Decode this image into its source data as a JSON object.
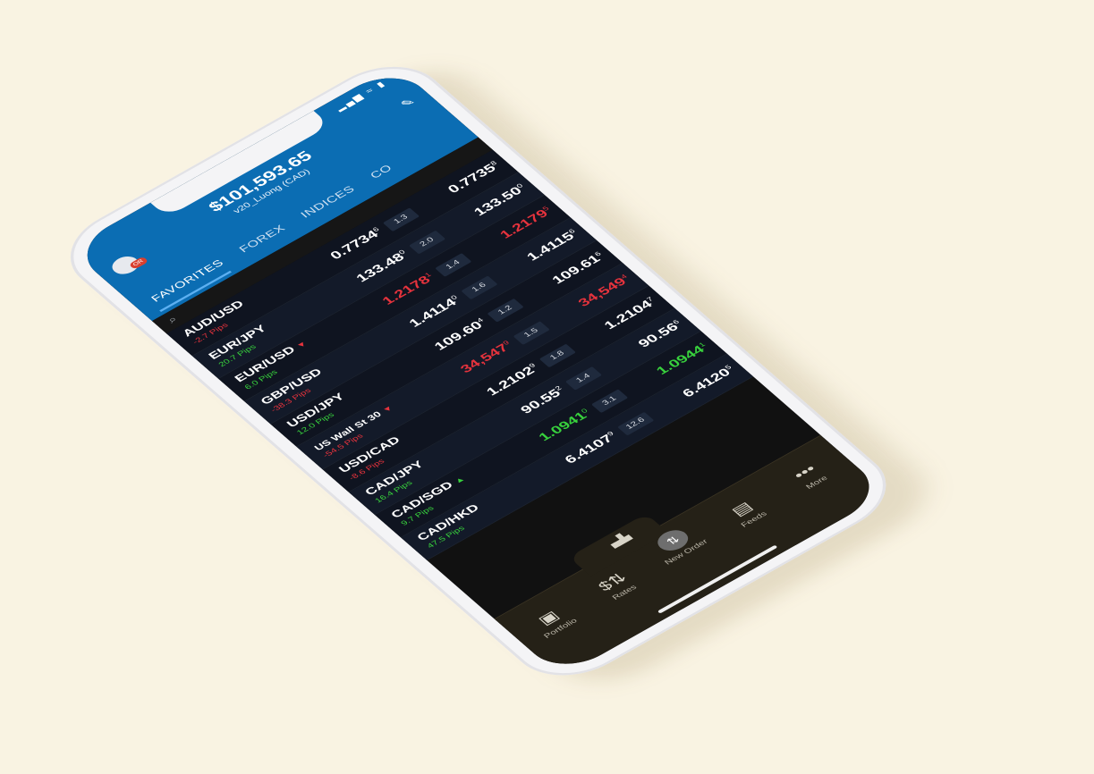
{
  "status": {
    "time": "",
    "icons": "▂▄▆ ≈ ▮"
  },
  "header": {
    "balance": "$101,593.65",
    "account": "v20_Luong (CAD)",
    "avatar_badge": "OR",
    "edit_icon": "pencil-icon",
    "tabs": [
      {
        "label": "FAVORITES",
        "active": true
      },
      {
        "label": "FOREX",
        "active": false
      },
      {
        "label": "INDICES",
        "active": false
      },
      {
        "label": "CO",
        "active": false
      }
    ]
  },
  "colors": {
    "header": "#0b6db3",
    "red": "#e6333d",
    "green": "#38d13d",
    "nav": "#252117"
  },
  "rates": [
    {
      "instrument": "AUD/USD",
      "trend": "",
      "pips": "-2.7 Pips",
      "pips_color": "red",
      "bid": "0.7734",
      "bid_sup": "6",
      "bid_color": "white",
      "spread": "1.3",
      "ask": "0.7735",
      "ask_sup": "8",
      "ask_color": "white"
    },
    {
      "instrument": "EUR/JPY",
      "trend": "",
      "pips": "20.7 Pips",
      "pips_color": "green",
      "bid": "133.48",
      "bid_sup": "0",
      "bid_color": "white",
      "spread": "2.0",
      "ask": "133.50",
      "ask_sup": "0",
      "ask_color": "white"
    },
    {
      "instrument": "EUR/USD",
      "trend": "▼",
      "trend_color": "red",
      "pips": "6.0 Pips",
      "pips_color": "green",
      "bid": "1.2178",
      "bid_sup": "1",
      "bid_color": "red",
      "spread": "1.4",
      "ask": "1.2179",
      "ask_sup": "5",
      "ask_color": "red"
    },
    {
      "instrument": "GBP/USD",
      "trend": "",
      "pips": "-38.3 Pips",
      "pips_color": "red",
      "bid": "1.4114",
      "bid_sup": "0",
      "bid_color": "white",
      "spread": "1.6",
      "ask": "1.4115",
      "ask_sup": "6",
      "ask_color": "white"
    },
    {
      "instrument": "USD/JPY",
      "trend": "",
      "pips": "12.0 Pips",
      "pips_color": "green",
      "bid": "109.60",
      "bid_sup": "4",
      "bid_color": "white",
      "spread": "1.2",
      "ask": "109.61",
      "ask_sup": "6",
      "ask_color": "white"
    },
    {
      "instrument": "US Wall St 30",
      "small": true,
      "trend": "▼",
      "trend_color": "red",
      "pips": "-54.5 Pips",
      "pips_color": "red",
      "bid": "34,547",
      "bid_sup": "9",
      "bid_color": "red",
      "spread": "1.5",
      "ask": "34,549",
      "ask_sup": "4",
      "ask_color": "red"
    },
    {
      "instrument": "USD/CAD",
      "trend": "",
      "pips": "-8.6 Pips",
      "pips_color": "red",
      "bid": "1.2102",
      "bid_sup": "9",
      "bid_color": "white",
      "spread": "1.8",
      "ask": "1.2104",
      "ask_sup": "7",
      "ask_color": "white"
    },
    {
      "instrument": "CAD/JPY",
      "trend": "",
      "pips": "16.4 Pips",
      "pips_color": "green",
      "bid": "90.55",
      "bid_sup": "2",
      "bid_color": "white",
      "spread": "1.4",
      "ask": "90.56",
      "ask_sup": "6",
      "ask_color": "white"
    },
    {
      "instrument": "CAD/SGD",
      "trend": "▲",
      "trend_color": "green",
      "pips": "9.7 Pips",
      "pips_color": "green",
      "bid": "1.0941",
      "bid_sup": "0",
      "bid_color": "green",
      "spread": "3.1",
      "ask": "1.0944",
      "ask_sup": "1",
      "ask_color": "green"
    },
    {
      "instrument": "CAD/HKD",
      "trend": "",
      "pips": "47.5 Pips",
      "pips_color": "green",
      "bid": "6.4107",
      "bid_sup": "9",
      "bid_color": "white",
      "spread": "12.6",
      "ask": "6.4120",
      "ask_sup": "5",
      "ask_color": "white"
    }
  ],
  "bottom_nav": {
    "items": [
      {
        "key": "portfolio",
        "label": "Portfolio",
        "icon": "briefcase-icon",
        "glyph": "▣"
      },
      {
        "key": "rates",
        "label": "Rates",
        "icon": "rates-icon",
        "glyph": "$⇅"
      },
      {
        "key": "new-order",
        "label": "New Order",
        "icon": "new-order-icon",
        "glyph": "⇅"
      },
      {
        "key": "feeds",
        "label": "Feeds",
        "icon": "feeds-icon",
        "glyph": "▤"
      },
      {
        "key": "more",
        "label": "More",
        "icon": "more-icon",
        "glyph": "•••"
      }
    ],
    "chart_icon": "chart-icon",
    "chart_glyph": "▗▟▖"
  }
}
